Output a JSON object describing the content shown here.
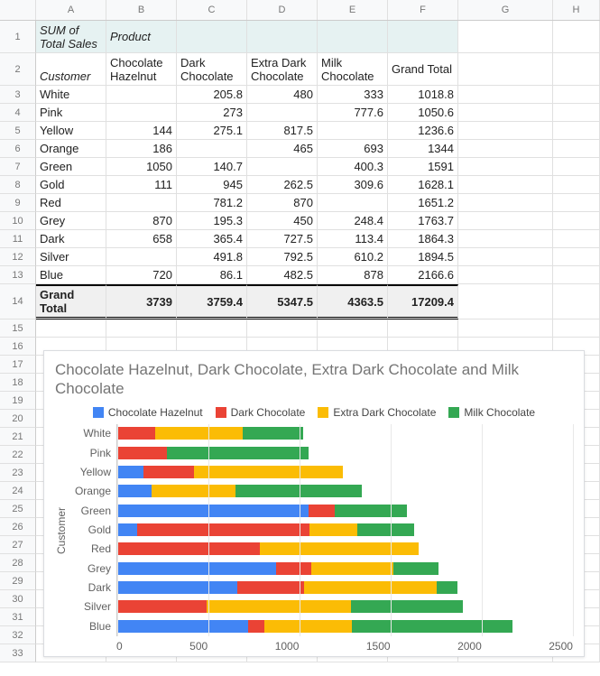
{
  "cols": [
    "A",
    "B",
    "C",
    "D",
    "E",
    "F",
    "G",
    "H"
  ],
  "pivot": {
    "measure": "SUM of Total Sales",
    "colfield": "Product",
    "rowfield": "Customer",
    "products": [
      "Chocolate Hazelnut",
      "Dark Chocolate",
      "Extra Dark Chocolate",
      "Milk Chocolate",
      "Grand Total"
    ],
    "rows": [
      {
        "c": "White",
        "v": [
          "",
          "205.8",
          "480",
          "333",
          "1018.8"
        ]
      },
      {
        "c": "Pink",
        "v": [
          "",
          "273",
          "",
          "777.6",
          "1050.6"
        ]
      },
      {
        "c": "Yellow",
        "v": [
          "144",
          "275.1",
          "817.5",
          "",
          "1236.6"
        ]
      },
      {
        "c": "Orange",
        "v": [
          "186",
          "",
          "465",
          "693",
          "1344"
        ]
      },
      {
        "c": "Green",
        "v": [
          "1050",
          "140.7",
          "",
          "400.3",
          "1591"
        ]
      },
      {
        "c": "Gold",
        "v": [
          "111",
          "945",
          "262.5",
          "309.6",
          "1628.1"
        ]
      },
      {
        "c": "Red",
        "v": [
          "",
          "781.2",
          "870",
          "",
          "1651.2"
        ]
      },
      {
        "c": "Grey",
        "v": [
          "870",
          "195.3",
          "450",
          "248.4",
          "1763.7"
        ]
      },
      {
        "c": "Dark",
        "v": [
          "658",
          "365.4",
          "727.5",
          "113.4",
          "1864.3"
        ]
      },
      {
        "c": "Silver",
        "v": [
          "",
          "491.8",
          "792.5",
          "610.2",
          "1894.5"
        ]
      },
      {
        "c": "Blue",
        "v": [
          "720",
          "86.1",
          "482.5",
          "878",
          "2166.6"
        ]
      }
    ],
    "grand": {
      "label": "Grand Total",
      "v": [
        "3739",
        "3759.4",
        "5347.5",
        "4363.5",
        "17209.4"
      ]
    }
  },
  "chart": {
    "title": "Chocolate Hazelnut, Dark Chocolate, Extra Dark Chocolate and Milk Chocolate",
    "ylabel": "Customer",
    "legend": [
      "Chocolate Hazelnut",
      "Dark Chocolate",
      "Extra Dark Chocolate",
      "Milk Chocolate"
    ],
    "colors": [
      "#4285F4",
      "#EA4335",
      "#FBBC05",
      "#34A853"
    ],
    "xticks": [
      "0",
      "500",
      "1000",
      "1500",
      "2000",
      "2500"
    ]
  },
  "chart_data": {
    "type": "bar",
    "orientation": "horizontal",
    "stacked": true,
    "xlabel": "",
    "ylabel": "Customer",
    "xlim": [
      0,
      2500
    ],
    "title": "Chocolate Hazelnut, Dark Chocolate, Extra Dark Chocolate and Milk Chocolate",
    "categories": [
      "White",
      "Pink",
      "Yellow",
      "Orange",
      "Green",
      "Gold",
      "Red",
      "Grey",
      "Dark",
      "Silver",
      "Blue"
    ],
    "series": [
      {
        "name": "Chocolate Hazelnut",
        "color": "#4285F4",
        "values": [
          0,
          0,
          144,
          186,
          1050,
          111,
          0,
          870,
          658,
          0,
          720
        ]
      },
      {
        "name": "Dark Chocolate",
        "color": "#EA4335",
        "values": [
          205.8,
          273,
          275.1,
          0,
          140.7,
          945,
          781.2,
          195.3,
          365.4,
          491.8,
          86.1
        ]
      },
      {
        "name": "Extra Dark Chocolate",
        "color": "#FBBC05",
        "values": [
          480,
          0,
          817.5,
          465,
          0,
          262.5,
          870,
          450,
          727.5,
          792.5,
          482.5
        ]
      },
      {
        "name": "Milk Chocolate",
        "color": "#34A853",
        "values": [
          333,
          777.6,
          0,
          693,
          400.3,
          309.6,
          0,
          248.4,
          113.4,
          610.2,
          878
        ]
      }
    ]
  }
}
